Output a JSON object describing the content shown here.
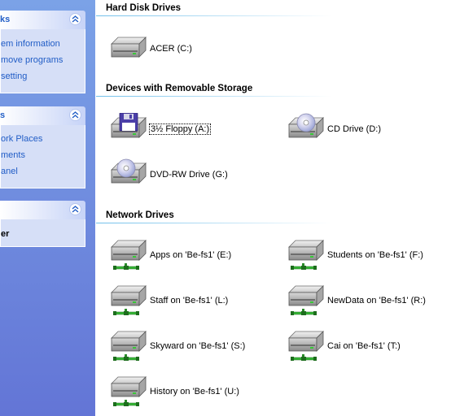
{
  "taskpane": {
    "panels": [
      {
        "title": "ks",
        "links": [
          "em information",
          "move programs",
          " setting"
        ]
      },
      {
        "title": "s",
        "links": [
          "ork Places",
          "ments",
          "anel"
        ]
      },
      {
        "title": "",
        "details_name": "er"
      }
    ]
  },
  "groups": {
    "hard_disk": {
      "title": "Hard Disk Drives",
      "drives": [
        {
          "label": "ACER (C:)",
          "icon": "hard-disk-icon"
        }
      ]
    },
    "removable": {
      "title": "Devices with Removable Storage",
      "drives": [
        {
          "label": "3½ Floppy (A:)",
          "icon": "floppy-drive-icon"
        },
        {
          "label": "CD Drive (D:)",
          "icon": "cd-drive-icon"
        },
        {
          "label": "DVD-RW Drive (G:)",
          "icon": "dvd-drive-icon"
        }
      ]
    },
    "network": {
      "title": "Network Drives",
      "drives": [
        {
          "label": "Apps on 'Be-fs1' (E:)",
          "icon": "network-drive-icon"
        },
        {
          "label": "Students on 'Be-fs1' (F:)",
          "icon": "network-drive-icon"
        },
        {
          "label": "Staff on 'Be-fs1' (L:)",
          "icon": "network-drive-icon"
        },
        {
          "label": "NewData on 'Be-fs1' (R:)",
          "icon": "network-drive-icon"
        },
        {
          "label": "Skyward on 'Be-fs1' (S:)",
          "icon": "network-drive-icon"
        },
        {
          "label": "Cai on 'Be-fs1' (T:)",
          "icon": "network-drive-icon"
        },
        {
          "label": "History on 'Be-fs1' (U:)",
          "icon": "network-drive-icon"
        }
      ]
    }
  }
}
